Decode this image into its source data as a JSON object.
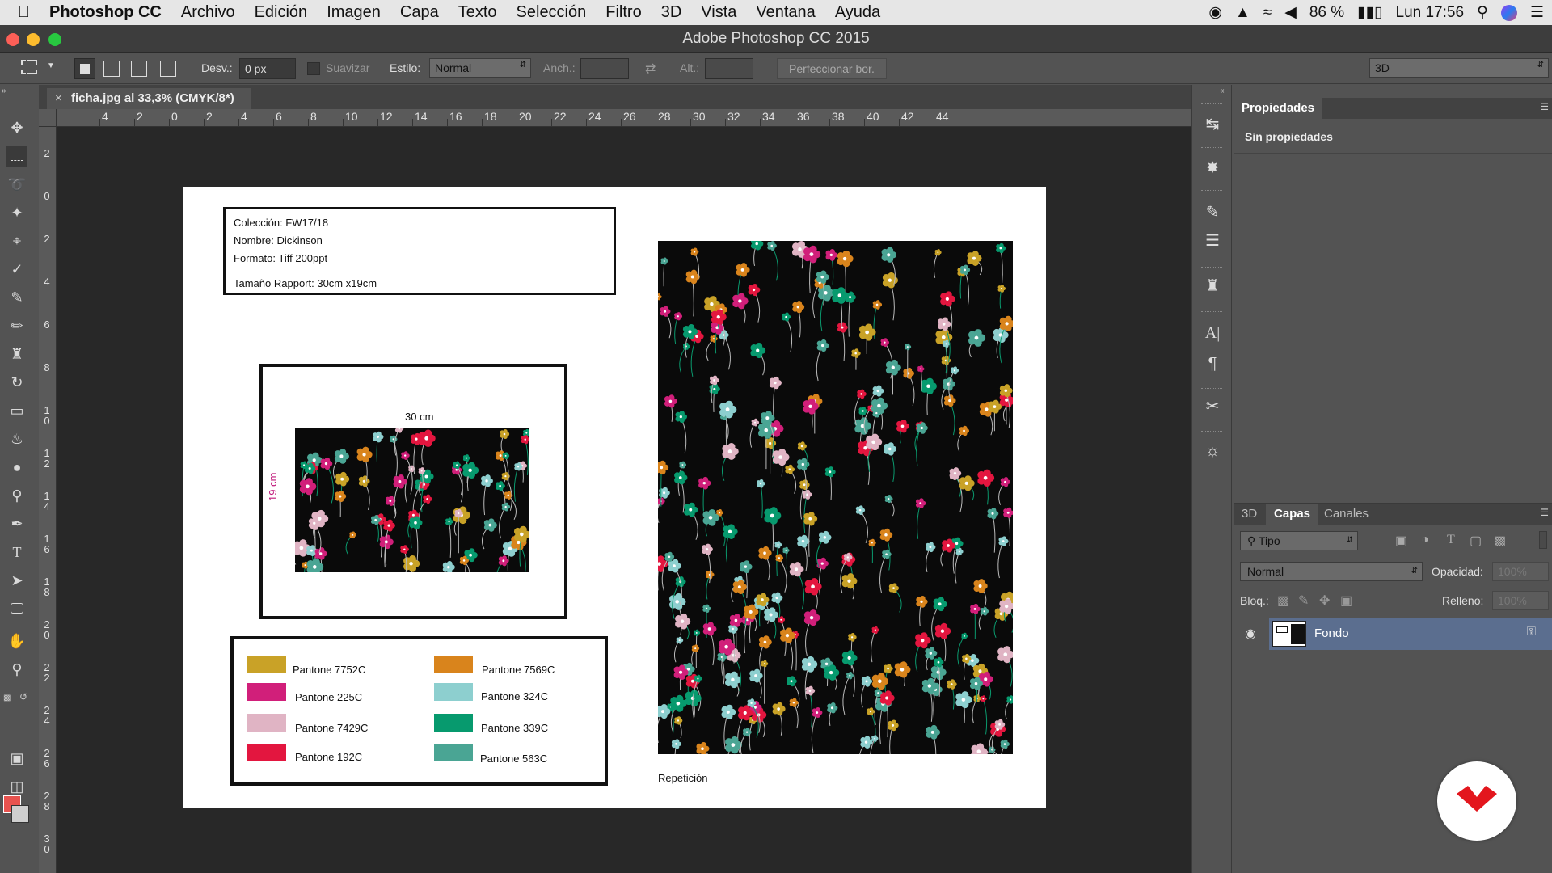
{
  "menubar": {
    "apple_icon": "apple-icon",
    "app_name": "Photoshop CC",
    "items": [
      "Archivo",
      "Edición",
      "Imagen",
      "Capa",
      "Texto",
      "Selección",
      "Filtro",
      "3D",
      "Vista",
      "Ventana",
      "Ayuda"
    ],
    "battery": "86 %",
    "clock": "Lun 17:56"
  },
  "window": {
    "title": "Adobe Photoshop CC 2015"
  },
  "options_bar": {
    "desv_label": "Desv.:",
    "desv_value": "0 px",
    "suavizar_label": "Suavizar",
    "estilo_label": "Estilo:",
    "estilo_value": "Normal",
    "anch_label": "Anch.:",
    "alt_label": "Alt.:",
    "refine_button": "Perfeccionar bor.",
    "workspace": "3D"
  },
  "document": {
    "tab_label": "ficha.jpg al 33,3% (CMYK/8*)",
    "hruler_labels": [
      "4",
      "2",
      "0",
      "2",
      "4",
      "6",
      "8",
      "10",
      "12",
      "14",
      "16",
      "18",
      "20",
      "22",
      "24",
      "26",
      "28",
      "30",
      "32",
      "34",
      "36",
      "38",
      "40",
      "42",
      "44"
    ],
    "vruler_labels": [
      "2",
      "0",
      "2",
      "4",
      "6",
      "8",
      "1\n0",
      "1\n2",
      "1\n4",
      "1\n6",
      "1\n8",
      "2\n0",
      "2\n2",
      "2\n4",
      "2\n6",
      "2\n8",
      "3\n0"
    ]
  },
  "sheet": {
    "info_lines": [
      "Colección: FW17/18",
      "Nombre: Dickinson",
      "Formato: Tiff 200ppt",
      "Tamaño Rapport: 30cm x19cm"
    ],
    "width_label": "30 cm",
    "height_label": "19 cm",
    "swatches": [
      {
        "name": "Pantone 7752C",
        "color": "#c9a227"
      },
      {
        "name": "Pantone 225C",
        "color": "#d11f7a"
      },
      {
        "name": "Pantone 7429C",
        "color": "#e0b4c4"
      },
      {
        "name": "Pantone 192C",
        "color": "#e3163f"
      },
      {
        "name": "Pantone 7569C",
        "color": "#d9841c"
      },
      {
        "name": "Pantone 324C",
        "color": "#8dcfcf"
      },
      {
        "name": "Pantone 339C",
        "color": "#079a6e"
      },
      {
        "name": "Pantone 563C",
        "color": "#4aa594"
      }
    ],
    "repeat_label": "Repetición"
  },
  "properties_panel": {
    "tab": "Propiedades",
    "content": "Sin propiedades"
  },
  "layers_panel": {
    "tabs": [
      "3D",
      "Capas",
      "Canales"
    ],
    "active_tab": "Capas",
    "filter": "Tipo",
    "blend_mode": "Normal",
    "opacity_label": "Opacidad:",
    "opacity_value": "100%",
    "lock_label": "Bloq.:",
    "fill_label": "Relleno:",
    "fill_value": "100%",
    "layer_name": "Fondo"
  },
  "colors": {
    "foreground": "#e8534f",
    "background": "#cfcfcf",
    "layer_selected": "#5b6e8f",
    "logo_red": "#e3161d"
  }
}
